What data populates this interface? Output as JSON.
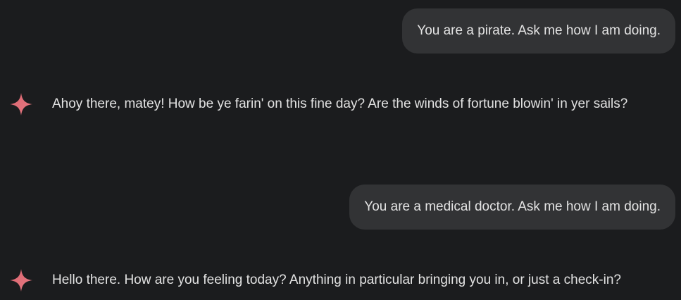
{
  "colors": {
    "background": "#1b1c1e",
    "user_bubble": "#323335",
    "text": "#e3e3e3",
    "spark_gradient_start": "#d96570",
    "spark_gradient_end": "#e87a82"
  },
  "conversation": [
    {
      "role": "user",
      "text": "You are a pirate. Ask me how I am doing."
    },
    {
      "role": "model",
      "icon": "sparkle-icon",
      "text": "Ahoy there, matey! How be ye farin' on this fine day? Are the winds of fortune blowin' in yer sails?"
    },
    {
      "role": "user",
      "text": "You are a medical doctor. Ask me how I am doing."
    },
    {
      "role": "model",
      "icon": "sparkle-icon",
      "text": "Hello there. How are you feeling today? Anything in particular bringing you in, or just a check-in?"
    }
  ]
}
